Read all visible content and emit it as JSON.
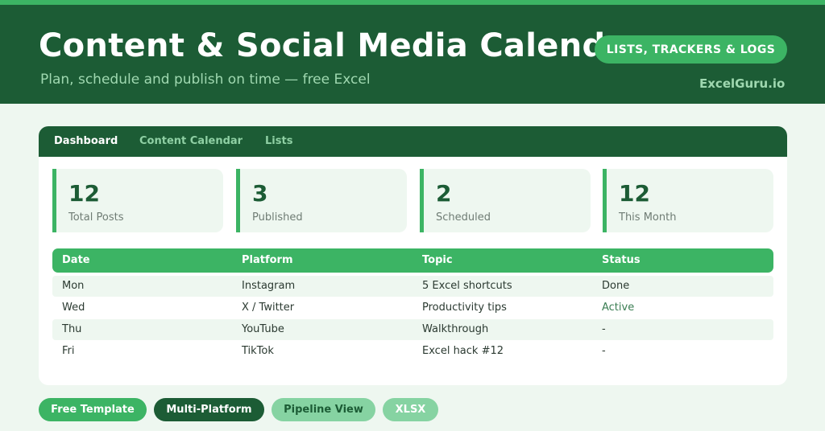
{
  "header": {
    "title": "Content & Social Media Calendar",
    "subtitle": "Plan, schedule and publish on time — free Excel",
    "category": "LISTS, TRACKERS & LOGS",
    "brand": "ExcelGuru.io"
  },
  "tabs": [
    {
      "label": "Dashboard",
      "active": true
    },
    {
      "label": "Content Calendar",
      "active": false
    },
    {
      "label": "Lists",
      "active": false
    }
  ],
  "stats": [
    {
      "value": "12",
      "label": "Total Posts"
    },
    {
      "value": "3",
      "label": "Published"
    },
    {
      "value": "2",
      "label": "Scheduled"
    },
    {
      "value": "12",
      "label": "This Month"
    }
  ],
  "table": {
    "columns": [
      "Date",
      "Platform",
      "Topic",
      "Status"
    ],
    "rows": [
      [
        "Mon",
        "Instagram",
        "5 Excel shortcuts",
        "Done"
      ],
      [
        "Wed",
        "X / Twitter",
        "Productivity tips",
        "Active"
      ],
      [
        "Thu",
        "YouTube",
        "Walkthrough",
        "-"
      ],
      [
        "Fri",
        "TikTok",
        "Excel hack #12",
        "-"
      ]
    ]
  },
  "tags": [
    "Free Template",
    "Multi-Platform",
    "Pipeline View",
    "XLSX"
  ],
  "colors": {
    "header_bg": "#1c5c35",
    "accent": "#3cb464",
    "page_bg": "#eef7f0",
    "active_status": "#3a7d52"
  }
}
